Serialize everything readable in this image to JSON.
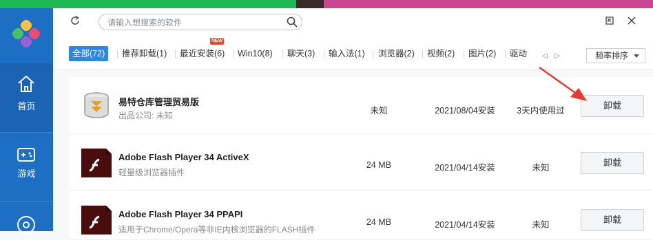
{
  "colors": {
    "sidebar": "#1d6fc4",
    "accent": "#2e86de",
    "new_badge": "#e8452b",
    "annotation_arrow": "#e53935"
  },
  "sidebar": {
    "items": [
      {
        "label": "首页",
        "icon": "home-icon"
      },
      {
        "label": "游戏",
        "icon": "gamepad-icon"
      },
      {
        "label": "",
        "icon": "disc-icon"
      }
    ]
  },
  "toolbar": {
    "search_placeholder": "请输入想搜索的软件"
  },
  "tabs": [
    {
      "label": "全部(72)",
      "active": true
    },
    {
      "label": "推荐卸载(1)"
    },
    {
      "label": "最近安装(6)",
      "badge": "NEW"
    },
    {
      "label": "Win10(8)"
    },
    {
      "label": "聊天(3)"
    },
    {
      "label": "输入法(1)"
    },
    {
      "label": "浏览器(2)"
    },
    {
      "label": "视频(2)"
    },
    {
      "label": "图片(2)"
    },
    {
      "label": "驱动"
    }
  ],
  "sort": {
    "selected": "频率排序"
  },
  "apps": [
    {
      "name": "易特仓库管理贸易版",
      "desc": "出品公司: 未知",
      "size": "未知",
      "date": "2021/08/04安装",
      "usage": "3天内使用过",
      "action": "卸载",
      "icon": "storage-app-icon"
    },
    {
      "name": "Adobe Flash Player 34 ActiveX",
      "desc": "轻量级浏览器插件",
      "size": "24 MB",
      "date": "2021/04/14安装",
      "usage": "未知",
      "action": "卸载",
      "icon": "flash-app-icon"
    },
    {
      "name": "Adobe Flash Player 34 PPAPI",
      "desc": "适用于Chrome/Opera等非IE内核浏览器的FLASH插件",
      "size": "24 MB",
      "date": "2021/04/14安装",
      "usage": "未知",
      "action": "卸载",
      "icon": "flash-app-icon"
    }
  ]
}
